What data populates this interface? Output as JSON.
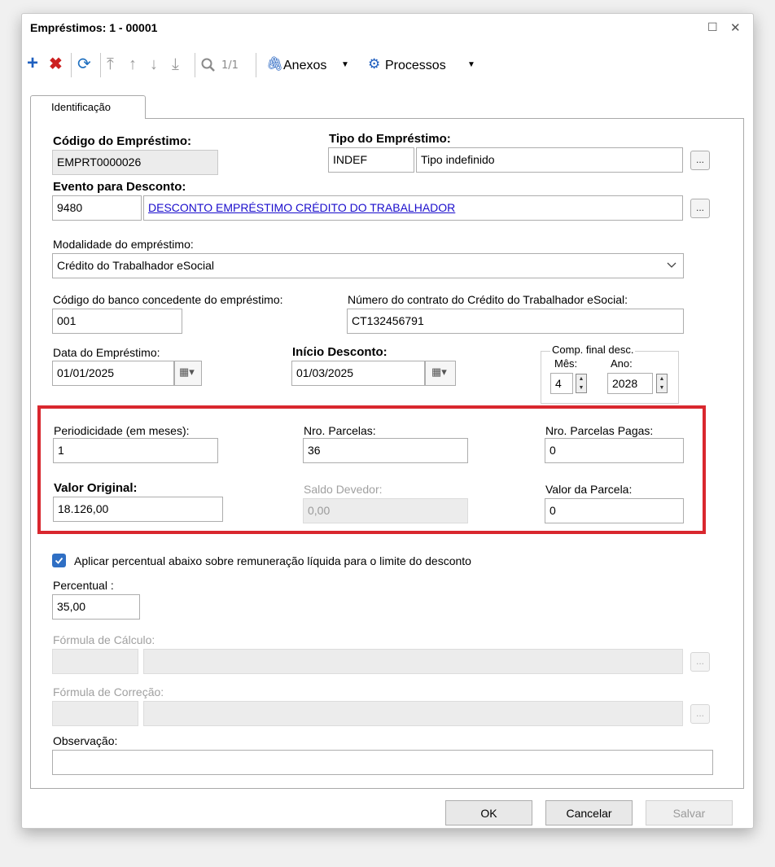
{
  "window": {
    "title": "Empréstimos: 1 - 00001",
    "maximize_glyph": "☐",
    "close_glyph": "✕"
  },
  "toolbar": {
    "pager": "1/1",
    "attachments_label": "Anexos",
    "processes_label": "Processos",
    "dropdown_glyph": "▼",
    "icons": [
      "plus-icon",
      "delete-icon",
      "refresh-icon",
      "first-icon",
      "prev-icon",
      "next-icon",
      "last-icon",
      "search-icon",
      "paperclip-icon",
      "gear-icon"
    ]
  },
  "tab": {
    "label": "Identificação"
  },
  "form": {
    "codigo_label": "Código do Empréstimo:",
    "codigo_value": "EMPRT0000026",
    "tipo_label": "Tipo do Empréstimo:",
    "tipo_code": "INDEF",
    "tipo_desc": "Tipo indefinido",
    "evento_label": "Evento para Desconto:",
    "evento_code": "9480",
    "evento_desc": "DESCONTO EMPRÉSTIMO CRÉDITO DO TRABALHADOR",
    "modalidade_label": "Modalidade do empréstimo:",
    "modalidade_value": "Crédito do Trabalhador eSocial",
    "banco_label": "Código do banco concedente do empréstimo:",
    "banco_value": "001",
    "contrato_label": "Número do contrato do Crédito do Trabalhador eSocial:",
    "contrato_value": "CT132456791",
    "data_label": "Data do Empréstimo:",
    "data_value": "01/01/2025",
    "inicio_label": "Início Desconto:",
    "inicio_value": "01/03/2025",
    "comp_label": "Comp. final desc.",
    "mes_label": "Mês:",
    "mes_value": "4",
    "ano_label": "Ano:",
    "ano_value": "2028",
    "periodicidade_label": "Periodicidade (em meses):",
    "periodicidade_value": "1",
    "nro_parcelas_label": "Nro. Parcelas:",
    "nro_parcelas_value": "36",
    "parcelas_pagas_label": "Nro. Parcelas Pagas:",
    "parcelas_pagas_value": "0",
    "valor_original_label": "Valor Original:",
    "valor_original_value": "18.126,00",
    "saldo_label": "Saldo Devedor:",
    "saldo_value": "0,00",
    "valor_parcela_label": "Valor da Parcela:",
    "valor_parcela_value": "0",
    "aplicar_label": "Aplicar percentual abaixo sobre remuneração líquida para o limite do desconto",
    "aplicar_checked": true,
    "percentual_label": "Percentual :",
    "percentual_value": "35,00",
    "formula_calc_label": "Fórmula de Cálculo:",
    "formula_corr_label": "Fórmula de Correção:",
    "observacao_label": "Observação:",
    "ellipsis": "..."
  },
  "footer": {
    "ok_label": "OK",
    "cancel_label": "Cancelar",
    "save_label": "Salvar"
  },
  "colors": {
    "highlight": "#d9272e",
    "link": "#1a0dcc",
    "checkbox": "#2f6fc4",
    "add_icon": "#1f5fbf",
    "delete_icon": "#cc1f1f"
  }
}
